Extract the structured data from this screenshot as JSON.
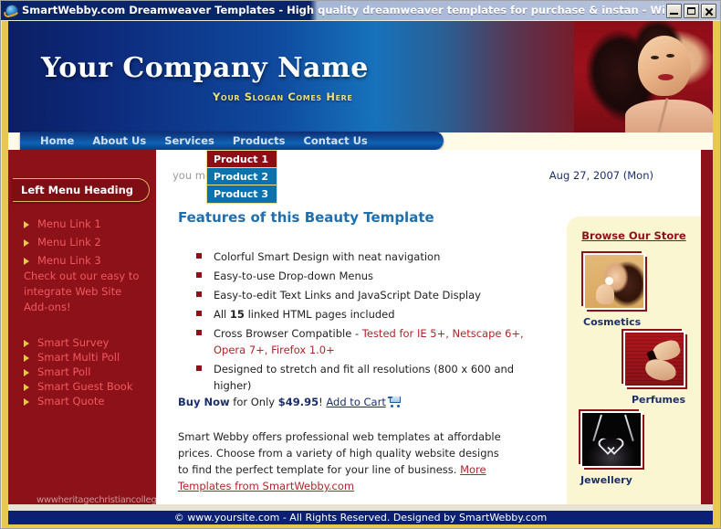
{
  "browser": {
    "title": "SmartWebby.com Dreamweaver Templates - High quality dreamweaver templates for purchase & instan - Windows Interne...",
    "icon": "internet-explorer-icon",
    "minimize_label": "",
    "maximize_label": "",
    "close_label": ""
  },
  "masthead": {
    "company_name": "Your Company Name",
    "slogan": "Your  Slogan Comes Here"
  },
  "nav": {
    "items": [
      {
        "label": "Home"
      },
      {
        "label": "About Us"
      },
      {
        "label": "Services"
      },
      {
        "label": "Products"
      },
      {
        "label": "Contact Us"
      }
    ]
  },
  "dropdown": {
    "open_for": "Products",
    "items": [
      {
        "label": "Product 1",
        "active": true
      },
      {
        "label": "Product 2",
        "active": false
      },
      {
        "label": "Product 3",
        "active": false
      }
    ]
  },
  "sidebar": {
    "heading": "Left Menu Heading",
    "links": [
      {
        "label": "Menu Link 1"
      },
      {
        "label": "Menu Link 2"
      },
      {
        "label": "Menu Link 3"
      }
    ],
    "note": "Check out our easy to integrate Web Site Add-ons!",
    "addons": [
      {
        "label": "Smart Survey"
      },
      {
        "label": "Smart Multi Poll"
      },
      {
        "label": "Smart Poll"
      },
      {
        "label": "Smart Guest Book"
      },
      {
        "label": "Smart Quote"
      }
    ]
  },
  "watermark": "wwwheritagechristiancollege.com",
  "main": {
    "welcome_partial": "you                 me",
    "date": "Aug 27, 2007 (Mon)",
    "features_title": "Features of this Beauty Template",
    "features": [
      {
        "text": "Colorful Smart Design with neat navigation"
      },
      {
        "text": "Easy-to-use Drop-down Menus"
      },
      {
        "text": "Easy-to-edit Text Links and JavaScript Date Display"
      },
      {
        "text": "All 15 linked HTML pages included",
        "bold_part": "15"
      },
      {
        "text": "Cross Browser Compatible - Tested for IE 5+, Netscape 6+, Opera 7+, Firefox 1.0+",
        "plain_part": "Cross Browser Compatible - ",
        "highlight_part": "Tested for IE 5+, Netscape 6+, Opera 7+, Firefox 1.0+"
      },
      {
        "text": "Designed to stretch and fit all resolutions (800 x 600 and higher)"
      }
    ],
    "buy": {
      "buy_now": "Buy Now",
      "for_only": " for Only ",
      "price": "$49.95",
      "exclaim": "! ",
      "cart_link": "Add to Cart",
      "cart_icon": "shopping-cart-icon"
    },
    "blurb": {
      "text": "Smart Webby offers professional web templates at affordable prices. Choose from a variety of high quality website designs to find the perfect template for your line of business. ",
      "link": "More Templates from SmartWebby.com"
    }
  },
  "store": {
    "title": "Browse Our Store",
    "items": [
      {
        "label": "Cosmetics",
        "thumb": "cosmetics-thumbnail"
      },
      {
        "label": "Perfumes",
        "thumb": "perfumes-thumbnail"
      },
      {
        "label": "Jewellery",
        "thumb": "jewellery-thumbnail"
      }
    ]
  },
  "footer": {
    "text": "© www.yoursite.com - All Rights Reserved. Designed by SmartWebby.com"
  },
  "colors": {
    "brand_red": "#8c1118",
    "brand_blue": "#0d1f72",
    "gold": "#e8c84a",
    "cream": "#fbf6d2",
    "link_red": "#b1252c",
    "heading_blue": "#1f6fad"
  }
}
